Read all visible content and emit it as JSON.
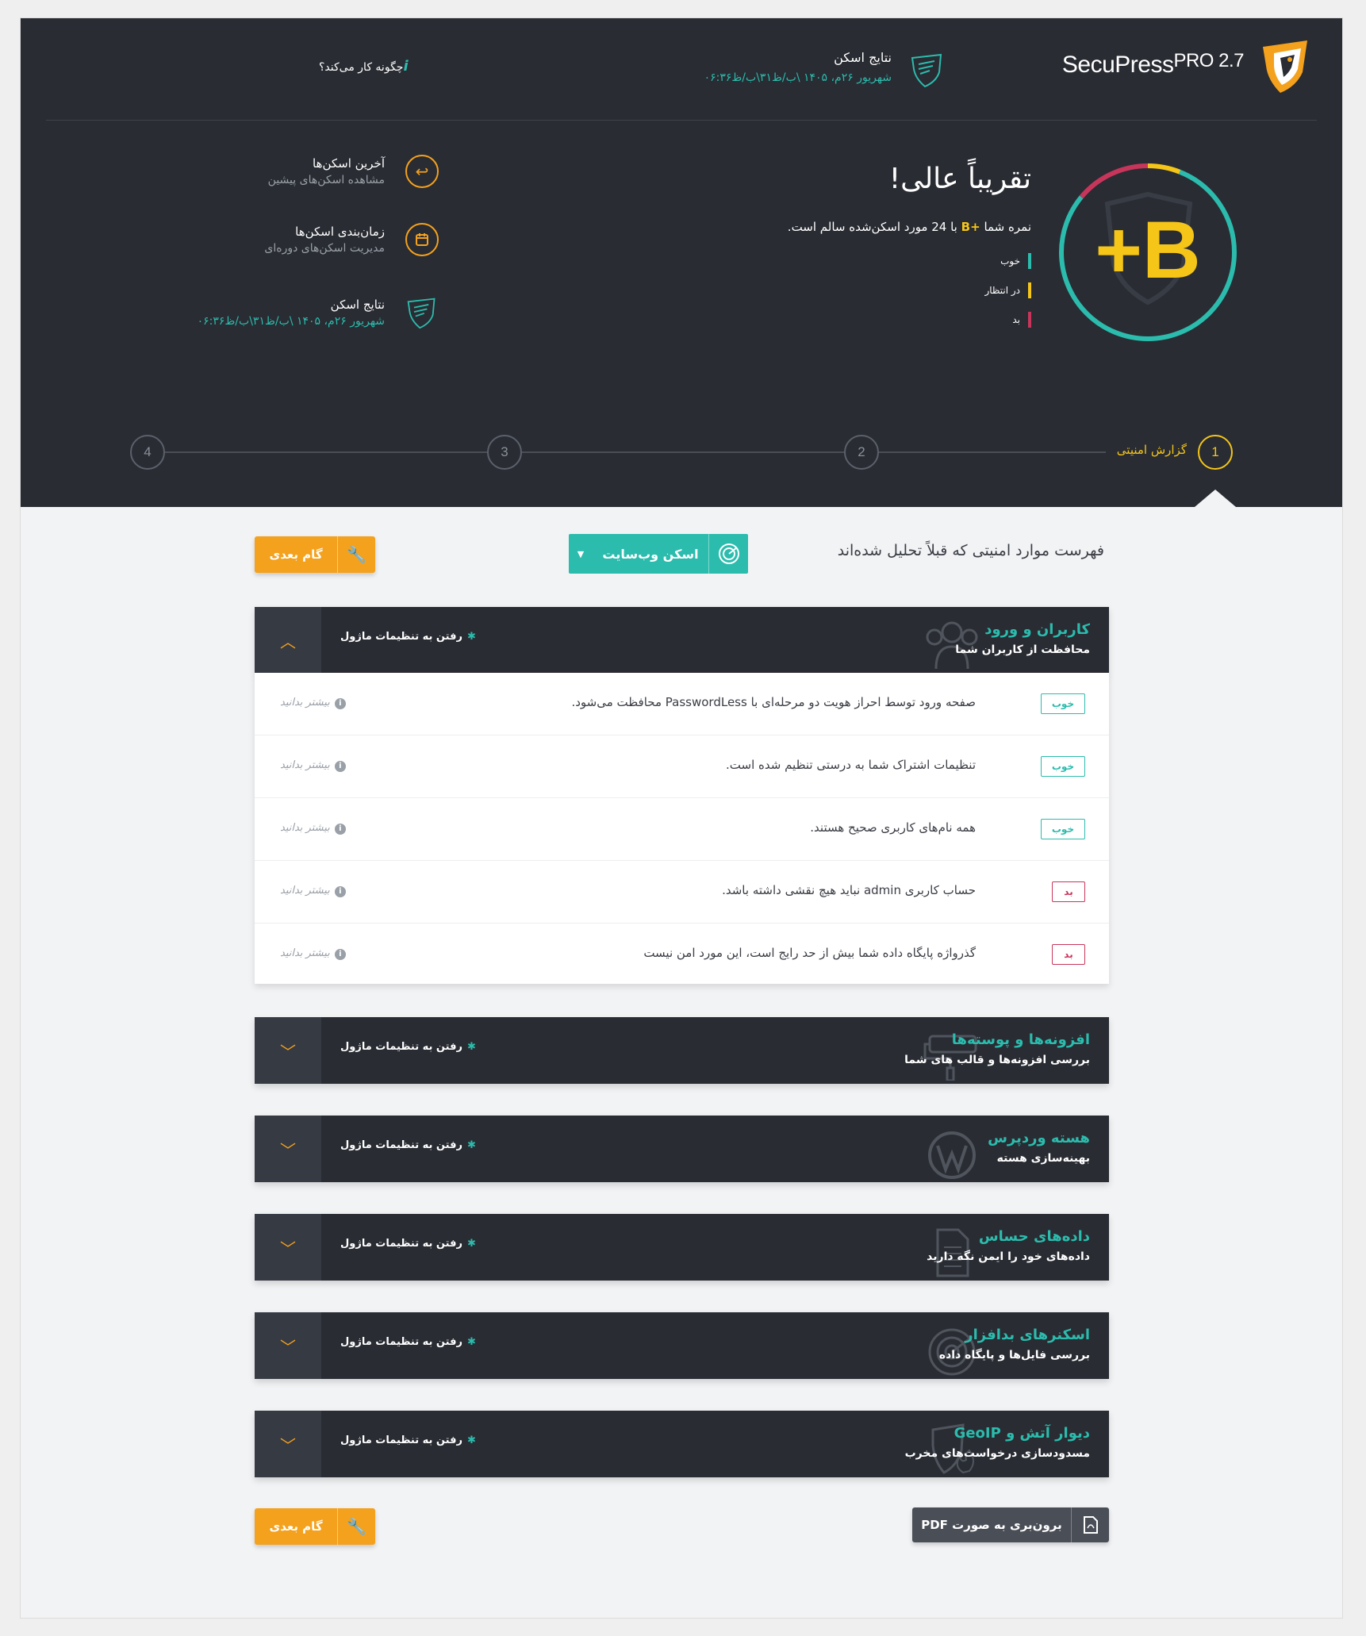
{
  "header": {
    "brand_name": "SecuPress",
    "brand_edition": "PRO 2.7",
    "top_scan_label": "نتایج اسکن",
    "top_scan_date": "شهریور ۲۶م، ۱۴۰۵ \\ب/ظ۳۱\\ب/ظ۰۶:۳۶",
    "how_it_works": "چگونه کار می‌کند؟",
    "how_it_works_icon": "i"
  },
  "score": {
    "grade": "+B",
    "title": "تقریباً عالی!",
    "line_prefix": "نمره شما",
    "line_grade": "+B",
    "line_suffix": "با 24 مورد اسکن‌شده سالم است.",
    "ring_colors": {
      "good": "#2bbcad",
      "warning": "#f5c518",
      "bad": "#c8355b"
    },
    "ring_shares": {
      "good": 0.8,
      "warning": 0.06,
      "bad": 0.14
    },
    "legend": [
      {
        "label": "خوب",
        "color": "#2bbcad"
      },
      {
        "label": "در انتظار",
        "color": "#f5c518"
      },
      {
        "label": "بد",
        "color": "#c8355b"
      }
    ]
  },
  "side_menu": [
    {
      "title": "آخرین اسکن‌ها",
      "subtitle": "مشاهده اسکن‌های پیشین",
      "icon": "undo-icon"
    },
    {
      "title": "زمان‌بندی اسکن‌ها",
      "subtitle": "مدیریت اسکن‌های دوره‌ای",
      "icon": "calendar-icon"
    },
    {
      "title": "نتایج اسکن",
      "subtitle": "شهریور ۲۶م، ۱۴۰۵ \\ب/ظ۳۱\\ب/ظ۰۶:۳۶",
      "icon": "shield-icon"
    }
  ],
  "steps": [
    {
      "number": "1",
      "label": "گزارش امنیتی"
    },
    {
      "number": "2"
    },
    {
      "number": "3"
    },
    {
      "number": "4"
    }
  ],
  "toolbar": {
    "list_title": "فهرست موارد امنیتی که قبلاً تحلیل شده‌اند",
    "scan_button": "اسکن وب‌سایت",
    "next_button": "گام بعدی",
    "pdf_button": "برون‌بری به صورت PDF"
  },
  "module_link": "رفتن به تنظیمات ماژول",
  "sections": [
    {
      "title": "کاربران و ورود",
      "subtitle": "محافظت از کاربران شما",
      "icon": "users-icon",
      "expanded": true
    },
    {
      "title": "افزونه‌ها و پوسته‌ها",
      "subtitle": "بررسی افزونه‌ها و قالب های شما",
      "icon": "paint-roller-icon",
      "expanded": false
    },
    {
      "title": "هسته وردپرس",
      "subtitle": "بهینه‌سازی هسته",
      "icon": "wordpress-icon",
      "expanded": false
    },
    {
      "title": "داده‌های حساس",
      "subtitle": "داده‌های خود را ایمن نگه دارید",
      "icon": "document-icon",
      "expanded": false
    },
    {
      "title": "اسکنرهای بدافزار",
      "subtitle": "بررسی فایل‌ها و پایگاه داده",
      "icon": "radar-icon",
      "expanded": false
    },
    {
      "title": "دیوار آتش و GeoIP",
      "subtitle": "مسدودسازی درخواست‌های مخرب",
      "icon": "firewall-icon",
      "expanded": false
    }
  ],
  "results": [
    {
      "status": "خوب",
      "state": "good",
      "text": "صفحه ورود توسط احراز هویت دو مرحله‌ای با PasswordLess محافظت می‌شود."
    },
    {
      "status": "خوب",
      "state": "good",
      "text": "تنظیمات اشتراک شما به درستی تنظیم شده است."
    },
    {
      "status": "خوب",
      "state": "good",
      "text": "همه نام‌های کاربری صحیح هستند."
    },
    {
      "status": "بد",
      "state": "bad",
      "text": "حساب کاربری admin نباید هیچ نقشی داشته باشد."
    },
    {
      "status": "بد",
      "state": "bad",
      "text": "گذرواژه پایگاه داده شما بیش از حد رایج است، این مورد امن نیست"
    }
  ],
  "learn_more": "بیشتر بدانید"
}
